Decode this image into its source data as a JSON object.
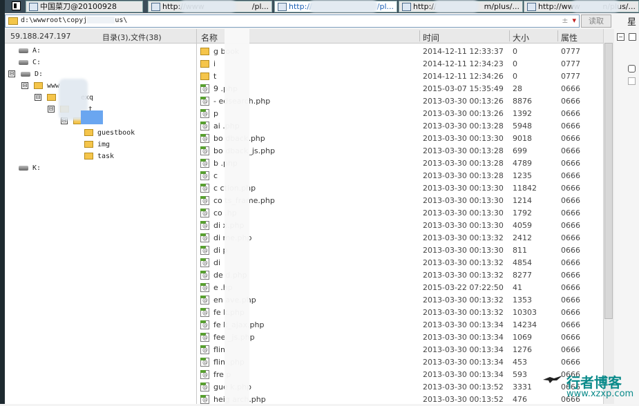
{
  "tabs": [
    {
      "label": "中国菜刀@20100928",
      "active": false
    },
    {
      "label": "http://www",
      "tail": "/pl...",
      "active": false
    },
    {
      "label": "http://",
      "tail": "/pl...",
      "active": true
    },
    {
      "label": "http://",
      "tail": "m/plus/...",
      "active": false
    },
    {
      "label": "http://www",
      "tail": "n/plus/...",
      "active": false
    }
  ],
  "address": {
    "path": "d:\\wwwroot\\copyj",
    "path_tail": "us\\",
    "btn_label": "读取",
    "right_label": "星"
  },
  "left": {
    "ip": "59.188.247.197",
    "summary": "目录(3),文件(38)",
    "tree": [
      {
        "label": "A:",
        "type": "drive"
      },
      {
        "label": "C:",
        "type": "drive"
      },
      {
        "label": "D:",
        "type": "drive",
        "expander": "⊟"
      },
      {
        "label": "www",
        "type": "folder",
        "expander": "⊟"
      },
      {
        "label": "exq",
        "type": "folder",
        "expander": "⊟"
      },
      {
        "label": "t",
        "type": "folder",
        "expander": "⊟"
      },
      {
        "label": "",
        "type": "folder",
        "expander": "⊟"
      },
      {
        "label": "guestbook",
        "type": "folder"
      },
      {
        "label": "img",
        "type": "folder"
      },
      {
        "label": "task",
        "type": "folder"
      },
      {
        "label": "K:",
        "type": "drive"
      }
    ]
  },
  "columns": {
    "name": "名称",
    "time": "时间",
    "size": "大小",
    "attr": "属性"
  },
  "files": [
    {
      "name": "g      book",
      "time": "2014-12-11 12:33:37",
      "size": "0",
      "attr": "0777",
      "type": "folder"
    },
    {
      "name": "i",
      "time": "2014-12-11 12:34:23",
      "size": "0",
      "attr": "0777",
      "type": "folder"
    },
    {
      "name": "t",
      "time": "2014-12-11 12:34:26",
      "size": "0",
      "attr": "0777",
      "type": "folder"
    },
    {
      "name": "9      .php",
      "time": "2015-03-07 15:35:49",
      "size": "28",
      "attr": "0666",
      "type": "php"
    },
    {
      "name": "-      edsearch.php",
      "time": "2013-03-30 00:13:26",
      "size": "8876",
      "attr": "0666",
      "type": "php"
    },
    {
      "name": "       p",
      "time": "2013-03-30 00:13:26",
      "size": "1392",
      "attr": "0666",
      "type": "php"
    },
    {
      "name": "ai     .php",
      "time": "2013-03-30 00:13:28",
      "size": "5948",
      "attr": "0666",
      "type": "php"
    },
    {
      "name": "bo     dback.php",
      "time": "2013-03-30 00:13:30",
      "size": "9018",
      "attr": "0666",
      "type": "php"
    },
    {
      "name": "bo     dback_js.php",
      "time": "2013-03-30 00:13:28",
      "size": "699",
      "attr": "0666",
      "type": "php"
    },
    {
      "name": "b      .php",
      "time": "2013-03-30 00:13:28",
      "size": "4789",
      "attr": "0666",
      "type": "php"
    },
    {
      "name": "c",
      "time": "2013-03-30 00:13:28",
      "size": "1235",
      "attr": "0666",
      "type": "php"
    },
    {
      "name": "c      ction.php",
      "time": "2013-03-30 00:13:30",
      "size": "11842",
      "attr": "0666",
      "type": "php"
    },
    {
      "name": "co     ts_frame.php",
      "time": "2013-03-30 00:13:30",
      "size": "1214",
      "attr": "0666",
      "type": "php"
    },
    {
      "name": "co     .hp",
      "time": "2013-03-30 00:13:30",
      "size": "1792",
      "attr": "0666",
      "type": "php"
    },
    {
      "name": "di     x.php",
      "time": "2013-03-30 00:13:30",
      "size": "4059",
      "attr": "0666",
      "type": "php"
    },
    {
      "name": "di     me.php",
      "time": "2013-03-30 00:13:32",
      "size": "2412",
      "attr": "0666",
      "type": "php"
    },
    {
      "name": "di     p",
      "time": "2013-03-30 00:13:30",
      "size": "811",
      "attr": "0666",
      "type": "php"
    },
    {
      "name": "di",
      "time": "2013-03-30 00:13:32",
      "size": "4854",
      "attr": "0666",
      "type": "php"
    },
    {
      "name": "de     d.php",
      "time": "2013-03-30 00:13:32",
      "size": "8277",
      "attr": "0666",
      "type": "php"
    },
    {
      "name": "e      .hp",
      "time": "2015-03-22 07:22:50",
      "size": "41",
      "attr": "0666",
      "type": "php"
    },
    {
      "name": "en     ave.php",
      "time": "2013-03-30 00:13:32",
      "size": "1353",
      "attr": "0666",
      "type": "php"
    },
    {
      "name": "fe     k.php",
      "time": "2013-03-30 00:13:32",
      "size": "10303",
      "attr": "0666",
      "type": "php"
    },
    {
      "name": "fe     k_ajax.php",
      "time": "2013-03-30 00:13:34",
      "size": "14234",
      "attr": "0666",
      "type": "php"
    },
    {
      "name": "fee    _js.php",
      "time": "2013-03-30 00:13:34",
      "size": "1069",
      "attr": "0666",
      "type": "php"
    },
    {
      "name": "flin",
      "time": "2013-03-30 00:13:34",
      "size": "1276",
      "attr": "0666",
      "type": "php"
    },
    {
      "name": "flin   .php",
      "time": "2013-03-30 00:13:34",
      "size": "453",
      "attr": "0666",
      "type": "php"
    },
    {
      "name": "fre    p",
      "time": "2013-03-30 00:13:34",
      "size": "593",
      "attr": "0666",
      "type": "php"
    },
    {
      "name": "gue    k.php",
      "time": "2013-03-30 00:13:52",
      "size": "3331",
      "attr": "0666",
      "type": "php"
    },
    {
      "name": "heig   arch.php",
      "time": "2013-03-30 00:13:52",
      "size": "476",
      "attr": "0666",
      "type": "php"
    }
  ],
  "watermark": {
    "text": "行者博客",
    "url": "www.xzxp.com"
  }
}
